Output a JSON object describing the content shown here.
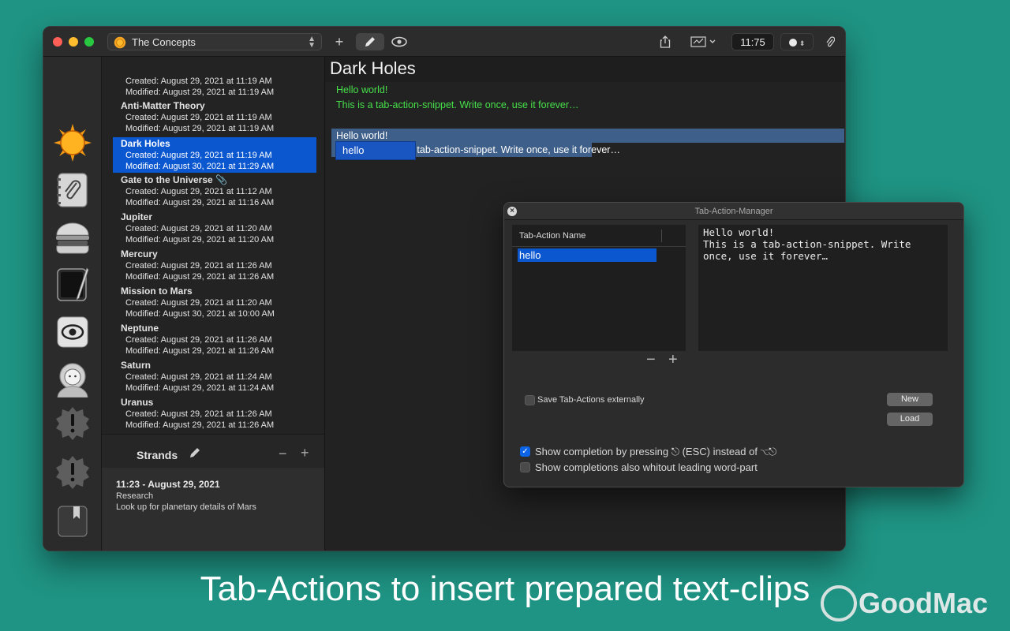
{
  "titlebar": {
    "document_select": "The Concepts",
    "time_display": "11:75"
  },
  "notes": [
    {
      "name": "",
      "created": "Created: August 29, 2021 at 11:19 AM",
      "modified": "Modified: August 29, 2021 at 11:19 AM"
    },
    {
      "name": "Anti-Matter Theory",
      "created": "Created: August 29, 2021 at 11:19 AM",
      "modified": "Modified: August 29, 2021 at 11:19 AM"
    },
    {
      "name": "Dark Holes",
      "created": "Created: August 29, 2021 at 11:19 AM",
      "modified": "Modified: August 30, 2021 at 11:29 AM",
      "selected": true
    },
    {
      "name": "Gate to the Universe 📎",
      "created": "Created: August 29, 2021 at 11:12 AM",
      "modified": "Modified: August 29, 2021 at 11:16 AM"
    },
    {
      "name": "Jupiter",
      "created": "Created: August 29, 2021 at 11:20 AM",
      "modified": "Modified: August 29, 2021 at 11:20 AM"
    },
    {
      "name": "Mercury",
      "created": "Created: August 29, 2021 at 11:26 AM",
      "modified": "Modified: August 29, 2021 at 11:26 AM"
    },
    {
      "name": "Mission to Mars",
      "created": "Created: August 29, 2021 at 11:20 AM",
      "modified": "Modified: August 30, 2021 at 10:00 AM"
    },
    {
      "name": "Neptune",
      "created": "Created: August 29, 2021 at 11:26 AM",
      "modified": "Modified: August 29, 2021 at 11:26 AM"
    },
    {
      "name": "Saturn",
      "created": "Created: August 29, 2021 at 11:24 AM",
      "modified": "Modified: August 29, 2021 at 11:24 AM"
    },
    {
      "name": "Uranus",
      "created": "Created: August 29, 2021 at 11:26 AM",
      "modified": "Modified: August 29, 2021 at 11:26 AM"
    }
  ],
  "strands": {
    "title": "Strands",
    "entry": {
      "title": "11:23 - August 29, 2021",
      "tag": "Research",
      "text": "Look up for planetary details of Mars"
    }
  },
  "editor": {
    "title": "Dark Holes",
    "line1": "Hello world!",
    "line2": "This is a tab-action-snippet. Write once, use it forever…",
    "line3": "Hello world!",
    "line4": "a tab-action-snippet. Write once, use it forever…",
    "popup": "hello"
  },
  "tab_action_manager": {
    "title": "Tab-Action-Manager",
    "column_header": "Tab-Action Name",
    "selected_item": "hello",
    "preview_lines": [
      "Hello world!",
      "This is a tab-action-snippet. Write",
      "once, use it forever…"
    ],
    "save_externally_label": "Save Tab-Actions externally",
    "new_button": "New",
    "load_button": "Load",
    "show_completion_label": "Show completion by pressing ⎋ (ESC) instead of ⌥⎋",
    "show_completion_checked": true,
    "show_completions_leading_label": "Show completions also whitout leading word-part",
    "show_completions_leading_checked": false
  },
  "caption": "Tab-Actions to insert prepared text-clips",
  "watermark": "GoodMac",
  "colors": {
    "background": "#1f9484",
    "selection": "#0b57d0",
    "editor_text": "#47e04a"
  }
}
